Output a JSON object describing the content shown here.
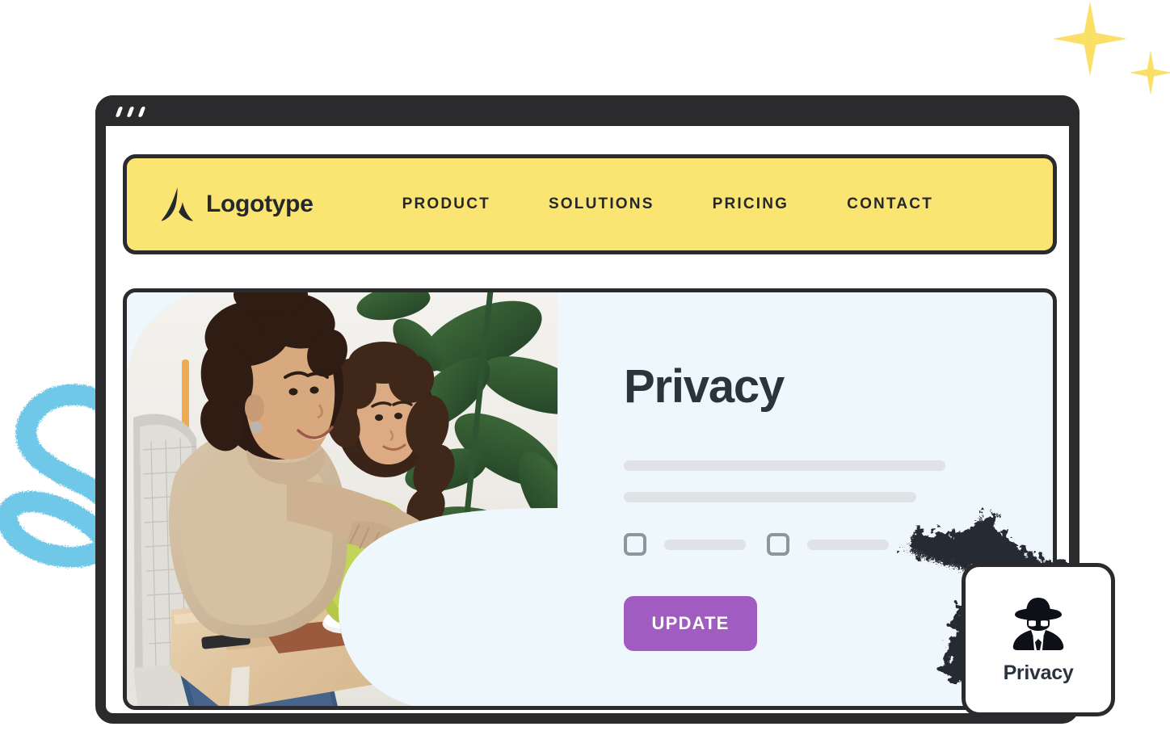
{
  "window": {
    "control_dots": [
      "dash-1",
      "dash-2",
      "dash-3"
    ]
  },
  "navbar": {
    "brand_name": "Logotype",
    "brand_icon": "logo-triangle-mark-icon",
    "links": [
      {
        "label": "PRODUCT"
      },
      {
        "label": "SOLUTIONS"
      },
      {
        "label": "PRICING"
      },
      {
        "label": "CONTACT"
      }
    ]
  },
  "main": {
    "photo_alt": "woman and girl at a desk using a computer with plants behind",
    "title": "Privacy",
    "skeleton_lines": 2,
    "checkboxes": [
      {
        "checked": false
      },
      {
        "checked": false
      }
    ],
    "update_label": "UPDATE"
  },
  "badge": {
    "icon": "spy-detective-icon",
    "label": "Privacy"
  },
  "decor": {
    "sparkle_large": "sparkle-icon",
    "sparkle_small": "sparkle-icon",
    "squiggle": "blue-spiral-squiggle",
    "splatter": "dark-particle-splatter"
  },
  "colors": {
    "yellow": "#fae573",
    "dark": "#2b2b2d",
    "panel_blue": "#eef7fc",
    "purple": "#a05cc0",
    "skeleton_gray": "#dfe3e6",
    "checkbox_gray": "#8d959d",
    "sparkle_yellow": "#fae066",
    "squiggle_blue": "#70c8e8"
  }
}
